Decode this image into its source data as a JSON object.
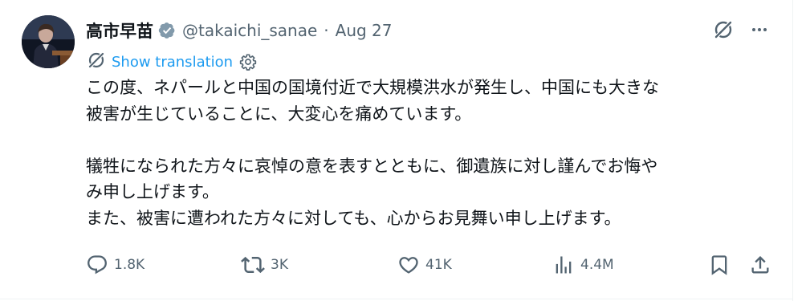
{
  "post": {
    "author_name": "高市早苗",
    "author_handle": "@takaichi_sanae",
    "separator": "·",
    "date": "Aug 27",
    "show_translation": "Show translation",
    "text_lines": [
      "この度、ネパールと中国の国境付近で大規模洪水が発生し、中国にも大きな",
      "被害が生じていることに、大変心を痛めています。",
      "",
      "犠牲になられた方々に哀悼の意を表すとともに、御遺族に対し謹んでお悔や",
      "み申し上げます。",
      "また、被害に遭われた方々に対しても、心からお見舞い申し上げます。"
    ]
  },
  "stats": {
    "replies": "1.8K",
    "reposts": "3K",
    "likes": "41K",
    "views": "4.4M"
  },
  "icons": {
    "verified": "verified-badge-icon",
    "grok": "grok-icon",
    "more": "more-icon",
    "translate": "grok-translate-icon",
    "settings": "settings-gear-icon",
    "reply": "reply-icon",
    "repost": "repost-icon",
    "like": "like-icon",
    "views": "views-icon",
    "bookmark": "bookmark-icon",
    "share": "share-icon"
  },
  "colors": {
    "text": "#0f1419",
    "secondary": "#536471",
    "link": "#1d9bf0",
    "verified_badge": "#829aab"
  }
}
